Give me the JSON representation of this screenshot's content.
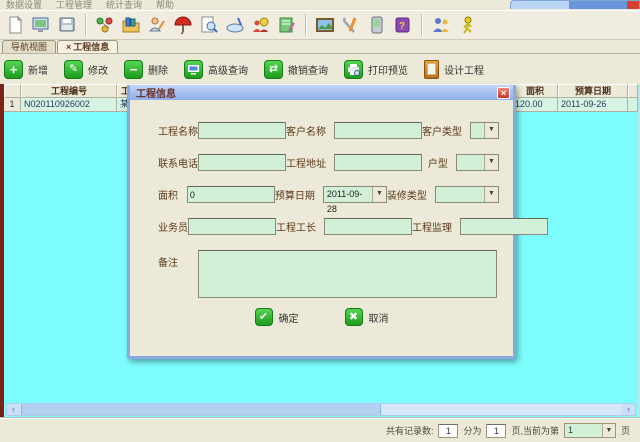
{
  "menu": {
    "items": [
      "数据设置",
      "工程管理",
      "统计查询",
      "帮助"
    ]
  },
  "tabs": {
    "nav": "导航视图",
    "active_close": "×",
    "active": "工程信息"
  },
  "toolbar_icons": [
    "new-doc-icon",
    "monitor-image-icon",
    "save-icon",
    "nodes-icon",
    "folder-books-icon",
    "user-edit-icon",
    "umbrella-icon",
    "search-doc-icon",
    "dish-pen-icon",
    "clock-users-icon",
    "notebook-pen-icon",
    "picture-icon",
    "tools-icon",
    "pda-icon",
    "help-book-icon",
    "users-icon",
    "qq-figure-icon"
  ],
  "actions": {
    "add": "新增",
    "edit": "修改",
    "delete": "删除",
    "adv_query": "高级查询",
    "undo_query": "撤销查询",
    "print_preview": "打印预览",
    "design": "设计工程"
  },
  "action_glyphs": {
    "plus": "+",
    "edit": "✎",
    "minus": "−",
    "refresh": "⇄"
  },
  "table": {
    "headers": {
      "index": "",
      "code": "工程编号",
      "partial": "工",
      "area": "面积",
      "budget_date": "预算日期"
    },
    "row": {
      "index": "1",
      "code": "N020110926002",
      "partial": "某",
      "area": "120.00",
      "budget_date": "2011-09-26"
    }
  },
  "scrollbar": {
    "left_arrow": "‹",
    "right_arrow": "›"
  },
  "dialog": {
    "title": "工程信息",
    "close": "×",
    "fields": {
      "project_name": "工程名称",
      "customer_name": "客户名称",
      "customer_type": "客户类型",
      "phone": "联系电话",
      "address": "工程地址",
      "house_type": "户型",
      "area": "面积",
      "area_value": "0",
      "budget_date": "预算日期",
      "budget_date_value": "2011-09-28",
      "deco_type": "装修类型",
      "salesman": "业务员",
      "foreman": "工程工长",
      "supervisor": "工程监理",
      "remark": "备注"
    },
    "ok": "确定",
    "cancel": "取消",
    "ok_glyph": "✔",
    "cancel_glyph": "✖",
    "combo_arrow": "▼"
  },
  "statusbar": {
    "total_label": "共有记录数:",
    "total": "1",
    "split_label": "分为",
    "pages": "1",
    "page_label": "页,当前为第",
    "current": "1",
    "unit": "页",
    "combo_arrow": "▼"
  },
  "colors": {
    "cyan": "#7dfdfe",
    "beige": "#ece9d8",
    "mint": "#d2efd8",
    "action_green": "#23a223",
    "left_strip": "#7b2218",
    "title_text": "#6d3226"
  }
}
